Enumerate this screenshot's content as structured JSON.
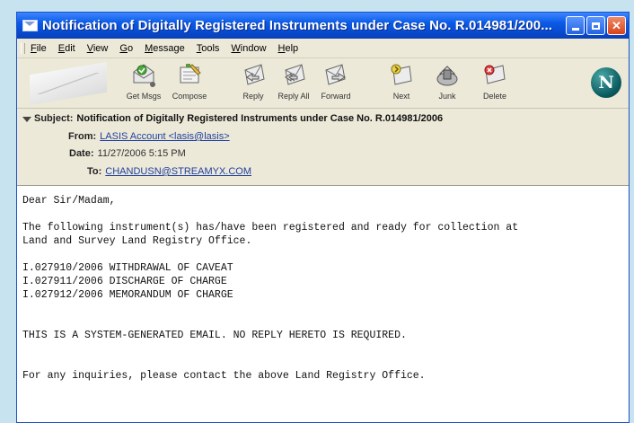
{
  "window": {
    "title": "Notification of Digitally Registered Instruments under Case No. R.014981/200...",
    "minimize_label": "",
    "maximize_label": "",
    "close_label": "✕"
  },
  "menu": [
    {
      "label": "File"
    },
    {
      "label": "Edit"
    },
    {
      "label": "View"
    },
    {
      "label": "Go"
    },
    {
      "label": "Message"
    },
    {
      "label": "Tools"
    },
    {
      "label": "Window"
    },
    {
      "label": "Help"
    }
  ],
  "toolbar": [
    {
      "label": "Get Msgs",
      "icon": "get-messages-icon"
    },
    {
      "label": "Compose",
      "icon": "compose-icon"
    },
    {
      "label": "Reply",
      "icon": "reply-icon"
    },
    {
      "label": "Reply All",
      "icon": "reply-all-icon"
    },
    {
      "label": "Forward",
      "icon": "forward-icon"
    },
    {
      "label": "Next",
      "icon": "next-icon"
    },
    {
      "label": "Junk",
      "icon": "junk-icon"
    },
    {
      "label": "Delete",
      "icon": "delete-icon"
    }
  ],
  "header": {
    "subject_label": "Subject:",
    "subject": "Notification of Digitally Registered Instruments under Case No. R.014981/2006",
    "from_label": "From:",
    "from": "LASIS Account <lasis@lasis>",
    "date_label": "Date:",
    "date": "11/27/2006 5:15 PM",
    "to_label": "To:",
    "to": "CHANDUSN@STREAMYX.COM"
  },
  "body": {
    "greeting": "Dear Sir/Madam,",
    "line1": "The following instrument(s) has/have been registered and ready for collection at",
    "line2": "Land and Survey Land Registry Office.",
    "instruments": [
      "I.027910/2006 WITHDRAWAL OF CAVEAT",
      "I.027911/2006 DISCHARGE OF CHARGE",
      "I.027912/2006 MEMORANDUM OF CHARGE"
    ],
    "system_note": "THIS IS A SYSTEM-GENERATED EMAIL. NO REPLY HERETO IS REQUIRED.",
    "inquiry": "For any inquiries, please contact the above Land Registry Office."
  },
  "colors": {
    "titlebar": "#0a5ae6",
    "background": "#c8e3f0",
    "link": "#1f3f9f"
  }
}
